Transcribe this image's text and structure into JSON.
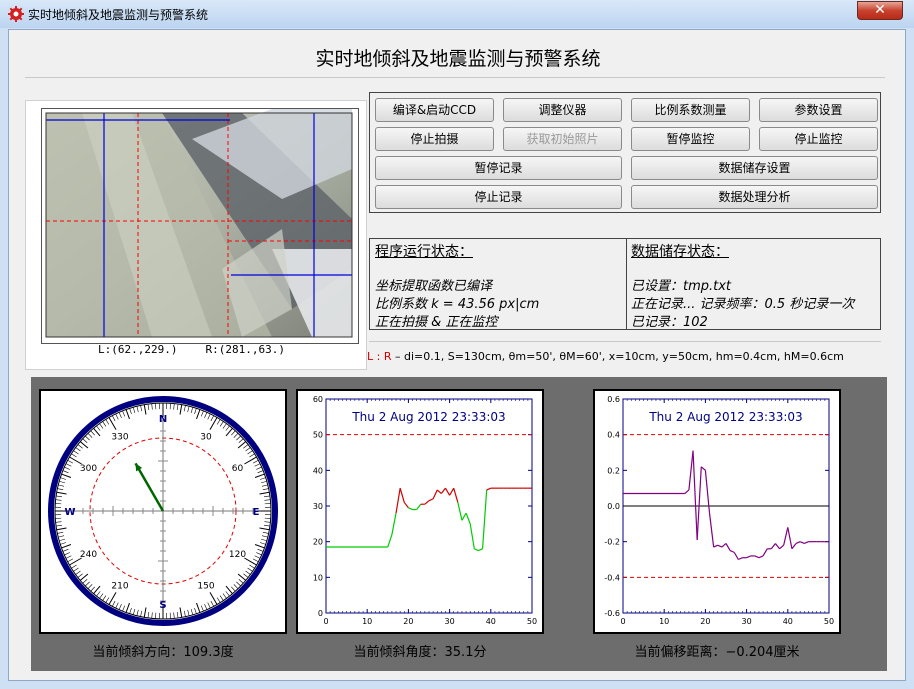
{
  "window": {
    "title": "实时地倾斜及地震监测与预警系统",
    "close_label": "✕"
  },
  "app": {
    "heading": "实时地倾斜及地震监测与预警系统"
  },
  "camera": {
    "left_coord": "L:(62.,229.)",
    "right_coord": "R:(281.,63.)"
  },
  "buttons": {
    "compile_start": "编译&启动CCD",
    "adjust": "调整仪器",
    "ratio_measure": "比例系数测量",
    "params": "参数设置",
    "stop_capture": "停止拍摄",
    "get_initial": "获取初始照片",
    "pause_monitor": "暂停监控",
    "stop_monitor": "停止监控",
    "pause_record": "暂停记录",
    "storage_settings": "数据储存设置",
    "stop_record": "停止记录",
    "analysis": "数据处理分析"
  },
  "status": {
    "run_title": "程序运行状态：",
    "run_lines": [
      "坐标提取函数已编译",
      "比例系数  k  = 43.56 px|cm",
      "正在拍摄  &  正在监控"
    ],
    "store_title": "数据储存状态：",
    "store_lines": [
      "已设置：tmp.txt",
      "正在记录... 记录频率：0.5 秒记录一次",
      "已记录：102"
    ]
  },
  "params": {
    "lr_label": "L : R",
    "text": " – di=0.1, S=130cm, θm=50', θM=60', x=10cm, y=50cm, hm=0.4cm, hM=0.6cm"
  },
  "compass": {
    "north": "N",
    "south": "S",
    "east": "E",
    "west": "W",
    "labels": [
      "30",
      "60",
      "120",
      "150",
      "210",
      "240",
      "300",
      "330"
    ],
    "direction_deg": 330,
    "caption": "当前倾斜方向：109.3度"
  },
  "colors": {
    "navy": "#000080",
    "red_dash": "#e00000",
    "green": "#00aa00",
    "purple": "#800080"
  },
  "chart_data": [
    {
      "type": "line",
      "title": "Thu 2 Aug 2012 23:33:03",
      "xlim": [
        0,
        50
      ],
      "ylim": [
        0,
        60
      ],
      "x_ticks": [
        0,
        10,
        20,
        30,
        40,
        50
      ],
      "y_ticks": [
        0,
        10,
        20,
        30,
        40,
        50,
        60
      ],
      "threshold": 50,
      "series": [
        {
          "x": [
            0,
            15,
            16,
            17,
            18,
            19,
            20,
            21,
            22,
            23,
            24,
            25,
            26,
            27,
            28,
            29,
            30,
            31,
            32,
            33,
            34,
            35,
            36,
            37,
            38,
            39,
            40,
            41,
            42,
            43,
            44,
            45,
            46,
            47,
            48,
            49,
            50
          ],
          "y": [
            18.5,
            18.5,
            22,
            28,
            35,
            31,
            29.5,
            29,
            29,
            30.5,
            30.5,
            31.5,
            32,
            34.5,
            33.5,
            35,
            33,
            35,
            31,
            26,
            28,
            25,
            18,
            17.5,
            18,
            34.5,
            35,
            35,
            35,
            35,
            35,
            35,
            35,
            35,
            35,
            35,
            35
          ],
          "colors": {
            "high": "#d00000",
            "low": "#00cc00",
            "split": 30
          }
        }
      ],
      "caption": "当前倾斜角度：35.1分"
    },
    {
      "type": "line",
      "title": "Thu 2 Aug 2012 23:33:03",
      "xlim": [
        0,
        50
      ],
      "ylim": [
        -0.6,
        0.6
      ],
      "x_ticks": [
        0,
        10,
        20,
        30,
        40,
        50
      ],
      "y_ticks": [
        -0.6,
        -0.4,
        -0.2,
        0.0,
        0.2,
        0.4,
        0.6
      ],
      "thresholds": [
        0.4,
        -0.4
      ],
      "series": [
        {
          "x": [
            0,
            15,
            16,
            17,
            18,
            19,
            20,
            21,
            22,
            23,
            24,
            25,
            26,
            27,
            28,
            29,
            30,
            31,
            32,
            33,
            34,
            35,
            36,
            37,
            38,
            39,
            40,
            41,
            42,
            43,
            44,
            45,
            46,
            47,
            48,
            49,
            50
          ],
          "y": [
            0.07,
            0.07,
            0.09,
            0.31,
            -0.19,
            0.22,
            0.2,
            -0.04,
            -0.23,
            -0.22,
            -0.23,
            -0.21,
            -0.25,
            -0.26,
            -0.3,
            -0.29,
            -0.29,
            -0.28,
            -0.28,
            -0.29,
            -0.28,
            -0.24,
            -0.24,
            -0.21,
            -0.24,
            -0.22,
            -0.12,
            -0.24,
            -0.21,
            -0.2,
            -0.21,
            -0.2,
            -0.2,
            -0.2,
            -0.2,
            -0.2,
            -0.2
          ],
          "color": "#800080"
        }
      ],
      "caption": "当前偏移距离：−0.204厘米"
    }
  ]
}
